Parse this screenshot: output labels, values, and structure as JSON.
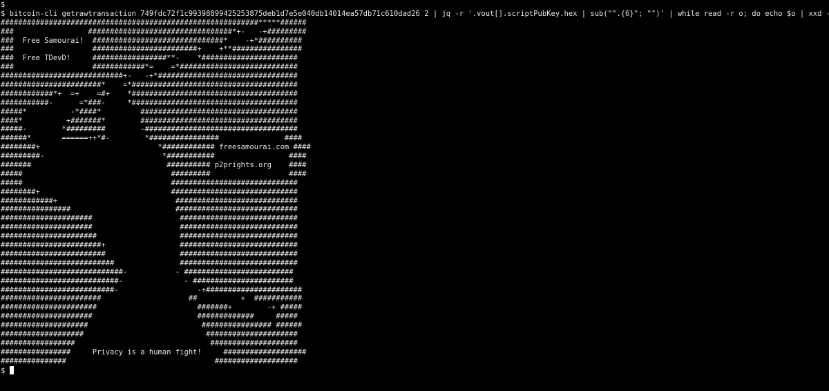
{
  "terminal": {
    "first_prompt": "$",
    "command_line": "$ bitcoin-cli getrawtransaction 749fdc72f1c99398899425253875deb1d7e5e040db14014ea57db71c610dad26 2 | jq -r '.vout[].scriptPubKey.hex | sub(\"^.{6}\"; \"\")' | while read -r o; do echo $o | xxd -p -r; echo; done",
    "output_lines": [
      "###########################################################*****######",
      "###                 #################################*+-   -+#########",
      "###  Free Samourai!  ##############################*    -+*##########",
      "###                  ########################+    +**################",
      "###  Free TDevD!     #################**-    *######################",
      "###                  ############*=    =*###########################",
      "############################+-   -+*################################",
      "#######################*    =*######################################",
      "############*+  =+    =#+    *######################################",
      "###########-      =*###-     *######################################",
      "#####*          -*####*         ####################################",
      "####*          +#######*        ####################################",
      "#####-        *#########        -###################################",
      "######*       ======++*#-        *################               ####",
      "########+                           *############ freesamourai.com ####",
      "#########-                           *###########                 ####",
      "#######                               ########## p2prights.org    ####",
      "#####                                  #########                  ####",
      "#####                                  #############################",
      "########+                              #############################",
      "############+                           ############################",
      "################                        ############################",
      "#####################                    ###########################",
      "#####################                    ###########################",
      "######################                   ###########################",
      "#######################+                 ###########################",
      "########################                 ###########################",
      "##########################               ###########################",
      "############################-           - #########################",
      "###########################-              - #######################",
      "##########################-                  -+######################",
      "#######################                    ##          +  ###########",
      "######################                       #######+        -+ #####",
      "#####################                        #############     #####",
      "####################                          ################ ######",
      "###################                            #####################",
      "#################                               ####################",
      "################     Privacy is a human fight!     ###################",
      "###############                                  ###################"
    ],
    "last_prompt": "$ "
  }
}
